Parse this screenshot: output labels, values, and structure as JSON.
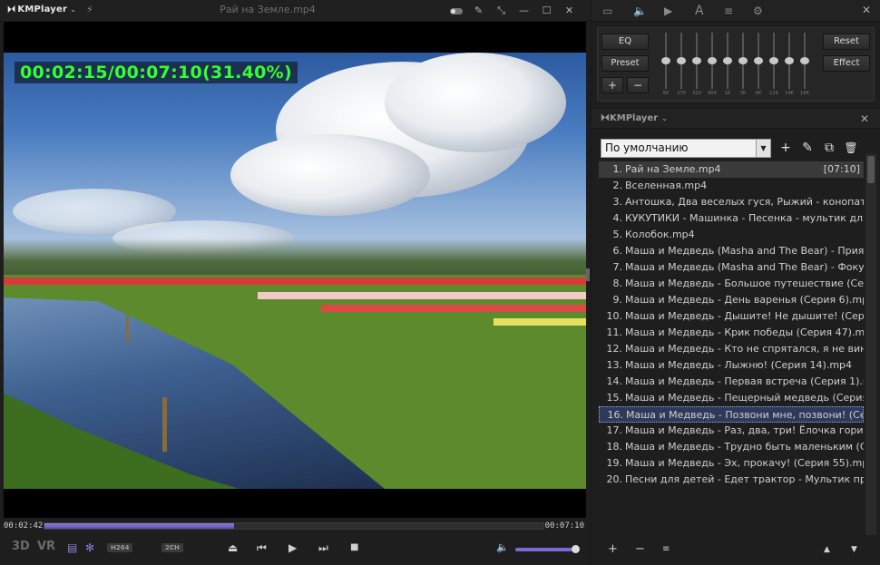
{
  "player": {
    "app_name": "KMPlayer",
    "window_title": "Рай на Земле.mp4",
    "osd_text": "00:02:15/00:07:10(31.40%)",
    "current_time": "00:02:42",
    "total_time": "00:07:10",
    "seek_progress_percent": 38,
    "volume_percent": 95,
    "badges": {
      "label_3d": "3D",
      "label_vr": "VR",
      "codec": "H264",
      "channels": "2CH"
    },
    "icons": {
      "bolt": "⚡",
      "dropdown": "⌄",
      "pin": "✎",
      "shrink": "⤡",
      "minimize": "—",
      "maximize": "☐",
      "close": "✕",
      "subtitle": "▤",
      "settings": "✻",
      "eject": "⏏",
      "prev": "⏮",
      "play": "▶",
      "next": "⏭",
      "stop": "■",
      "volume": "🔈"
    }
  },
  "equalizer": {
    "tabs": {
      "screen": "▭",
      "audio": "🔈",
      "play": "▶",
      "text": "A",
      "list": "≡",
      "gear": "⚙"
    },
    "buttons": {
      "eq": "EQ",
      "preset": "Preset",
      "plus": "+",
      "minus": "−",
      "reset": "Reset",
      "effect": "Effect"
    },
    "bands": [
      {
        "freq": "60",
        "level": 0
      },
      {
        "freq": "170",
        "level": 0
      },
      {
        "freq": "310",
        "level": 0
      },
      {
        "freq": "600",
        "level": 0
      },
      {
        "freq": "1K",
        "level": 0
      },
      {
        "freq": "3K",
        "level": 0
      },
      {
        "freq": "6K",
        "level": 0
      },
      {
        "freq": "12K",
        "level": 0
      },
      {
        "freq": "14K",
        "level": 0
      },
      {
        "freq": "16K",
        "level": 0
      }
    ]
  },
  "playlist": {
    "title": "KMPlayer",
    "selected_list": "По умолчанию",
    "tools": {
      "add": "+",
      "edit": "✎",
      "copy": "⧉",
      "delete": "🗑"
    },
    "items": [
      {
        "index": "1.",
        "title": "Рай на Земле.mp4",
        "duration": "[07:10]"
      },
      {
        "index": "2.",
        "title": "Вселенная.mp4",
        "duration": ""
      },
      {
        "index": "3.",
        "title": "Антошка, Два веселых гуся, Рыжий - конопать",
        "duration": ""
      },
      {
        "index": "4.",
        "title": "КУКУТИКИ - Машинка - Песенка - мультик для",
        "duration": ""
      },
      {
        "index": "5.",
        "title": "Колобок.mp4",
        "duration": ""
      },
      {
        "index": "6.",
        "title": "Маша и Медведь (Masha and The Bear) - Прият",
        "duration": ""
      },
      {
        "index": "7.",
        "title": "Маша и Медведь (Masha and The Bear) - Фокус",
        "duration": ""
      },
      {
        "index": "8.",
        "title": "Маша и Медведь - Большое путешествие (Сери",
        "duration": ""
      },
      {
        "index": "9.",
        "title": "Маша и Медведь - День варенья (Серия 6).mp",
        "duration": ""
      },
      {
        "index": "10.",
        "title": "Маша и Медведь - Дышите! Не дышите! (Серия",
        "duration": ""
      },
      {
        "index": "11.",
        "title": "Маша и Медведь - Крик победы (Серия 47).mp",
        "duration": ""
      },
      {
        "index": "12.",
        "title": "Маша и Медведь - Кто не спрятался, я не вин",
        "duration": ""
      },
      {
        "index": "13.",
        "title": "Маша и Медведь - Лыжню! (Серия 14).mp4",
        "duration": ""
      },
      {
        "index": "14.",
        "title": "Маша и Медведь - Первая встреча (Серия 1).n",
        "duration": ""
      },
      {
        "index": "15.",
        "title": "Маша и Медведь - Пещерный медведь (Серия",
        "duration": ""
      },
      {
        "index": "16.",
        "title": "Маша и Медведь - Позвони мне, позвони! (Сер",
        "duration": ""
      },
      {
        "index": "17.",
        "title": "Маша и Медведь - Раз, два, три! Ёлочка гори!",
        "duration": ""
      },
      {
        "index": "18.",
        "title": "Маша и Медведь - Трудно быть маленьким (Се",
        "duration": ""
      },
      {
        "index": "19.",
        "title": "Маша и Медведь - Эх, прокачу! (Серия 55).mp",
        "duration": ""
      },
      {
        "index": "20.",
        "title": "Песни для детей - Едет трактор - Мультик пр",
        "duration": ""
      }
    ],
    "current_item": 0,
    "selected_item": 15,
    "bottom": {
      "add": "+",
      "remove": "−",
      "menu": "≡",
      "up": "▲",
      "down": "▼"
    }
  }
}
